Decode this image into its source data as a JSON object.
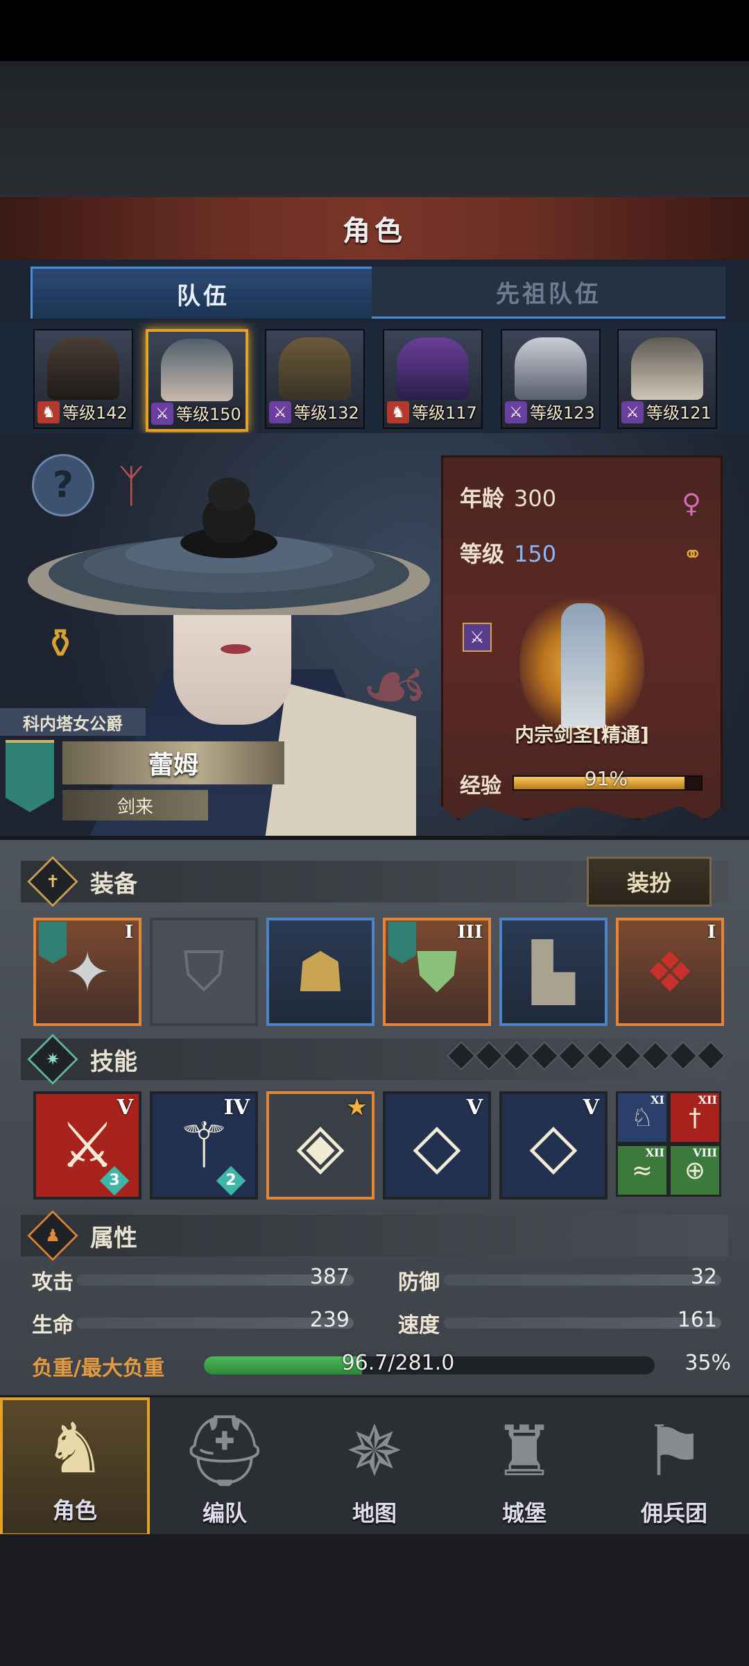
{
  "header": {
    "title": "角色"
  },
  "tabs": [
    {
      "label": "队伍",
      "active": true
    },
    {
      "label": "先祖队伍",
      "active": false
    }
  ],
  "heroes": [
    {
      "level_text": "等级142",
      "class_icon": "horse-icon",
      "class_color": "#b33a2c",
      "selected": false
    },
    {
      "level_text": "等级150",
      "class_icon": "sword-icon",
      "class_color": "#6b3fa0",
      "selected": true
    },
    {
      "level_text": "等级132",
      "class_icon": "sword-icon",
      "class_color": "#6b3fa0",
      "selected": false
    },
    {
      "level_text": "等级117",
      "class_icon": "horse-icon",
      "class_color": "#b33a2c",
      "selected": false
    },
    {
      "level_text": "等级123",
      "class_icon": "sword-icon",
      "class_color": "#6b3fa0",
      "selected": false
    },
    {
      "level_text": "等级121",
      "class_icon": "sword-icon",
      "class_color": "#6b3fa0",
      "selected": false
    }
  ],
  "character": {
    "title": "科内塔女公爵",
    "name": "蕾姆",
    "subtitle": "剑来",
    "age_label": "年龄",
    "age": "300",
    "level_label": "等级",
    "level": "150",
    "class_name": "内宗剑圣[精通]",
    "exp_label": "经验",
    "exp_percent": "91%",
    "exp_fraction": 0.91
  },
  "equipment": {
    "label": "装备",
    "dress_button": "装扮",
    "slots": [
      {
        "name": "weapon-slot",
        "rank": "I",
        "rarity": "orange",
        "icon": "shuriken-icon"
      },
      {
        "name": "shield-slot",
        "rank": "",
        "rarity": "empty",
        "icon": "shield-icon"
      },
      {
        "name": "hood-slot",
        "rank": "",
        "rarity": "blue",
        "icon": "hood-icon"
      },
      {
        "name": "armor-slot",
        "rank": "III",
        "rarity": "orange",
        "icon": "armor-icon"
      },
      {
        "name": "boots-slot",
        "rank": "",
        "rarity": "blue",
        "icon": "boots-icon"
      },
      {
        "name": "charm-slot",
        "rank": "I",
        "rarity": "orange",
        "icon": "knot-charm-icon"
      }
    ]
  },
  "skills": {
    "label": "技能",
    "items": [
      {
        "rank": "V",
        "count": "3",
        "bg": "#a8231d"
      },
      {
        "rank": "IV",
        "count": "2",
        "bg": "#22314f"
      },
      {
        "rank": "",
        "count": "",
        "bg": "#3a3f45"
      },
      {
        "rank": "V",
        "count": "",
        "bg": "#22314f"
      },
      {
        "rank": "V",
        "count": "",
        "bg": "#22314f"
      }
    ],
    "minis": [
      {
        "rank": "XI",
        "bg": "#2a3f6a"
      },
      {
        "rank": "XII",
        "bg": "#a8231d"
      },
      {
        "rank": "XII",
        "bg": "#3b7a3a"
      },
      {
        "rank": "VIII",
        "bg": "#3b7a3a"
      }
    ]
  },
  "attributes": {
    "label": "属性",
    "attack_label": "攻击",
    "attack": "387",
    "defense_label": "防御",
    "defense": "32",
    "hp_label": "生命",
    "hp": "239",
    "speed_label": "速度",
    "speed": "161",
    "load_label": "负重/最大负重",
    "load": "96.7/281.0",
    "load_percent": "35%",
    "load_fraction": 0.35
  },
  "nav": [
    {
      "label": "角色",
      "icon": "knight-icon",
      "active": true
    },
    {
      "label": "编队",
      "icon": "helmet-icon",
      "active": false
    },
    {
      "label": "地图",
      "icon": "compass-icon",
      "active": false
    },
    {
      "label": "城堡",
      "icon": "castle-icon",
      "active": false
    },
    {
      "label": "佣兵团",
      "icon": "banner-icon",
      "active": false
    }
  ]
}
